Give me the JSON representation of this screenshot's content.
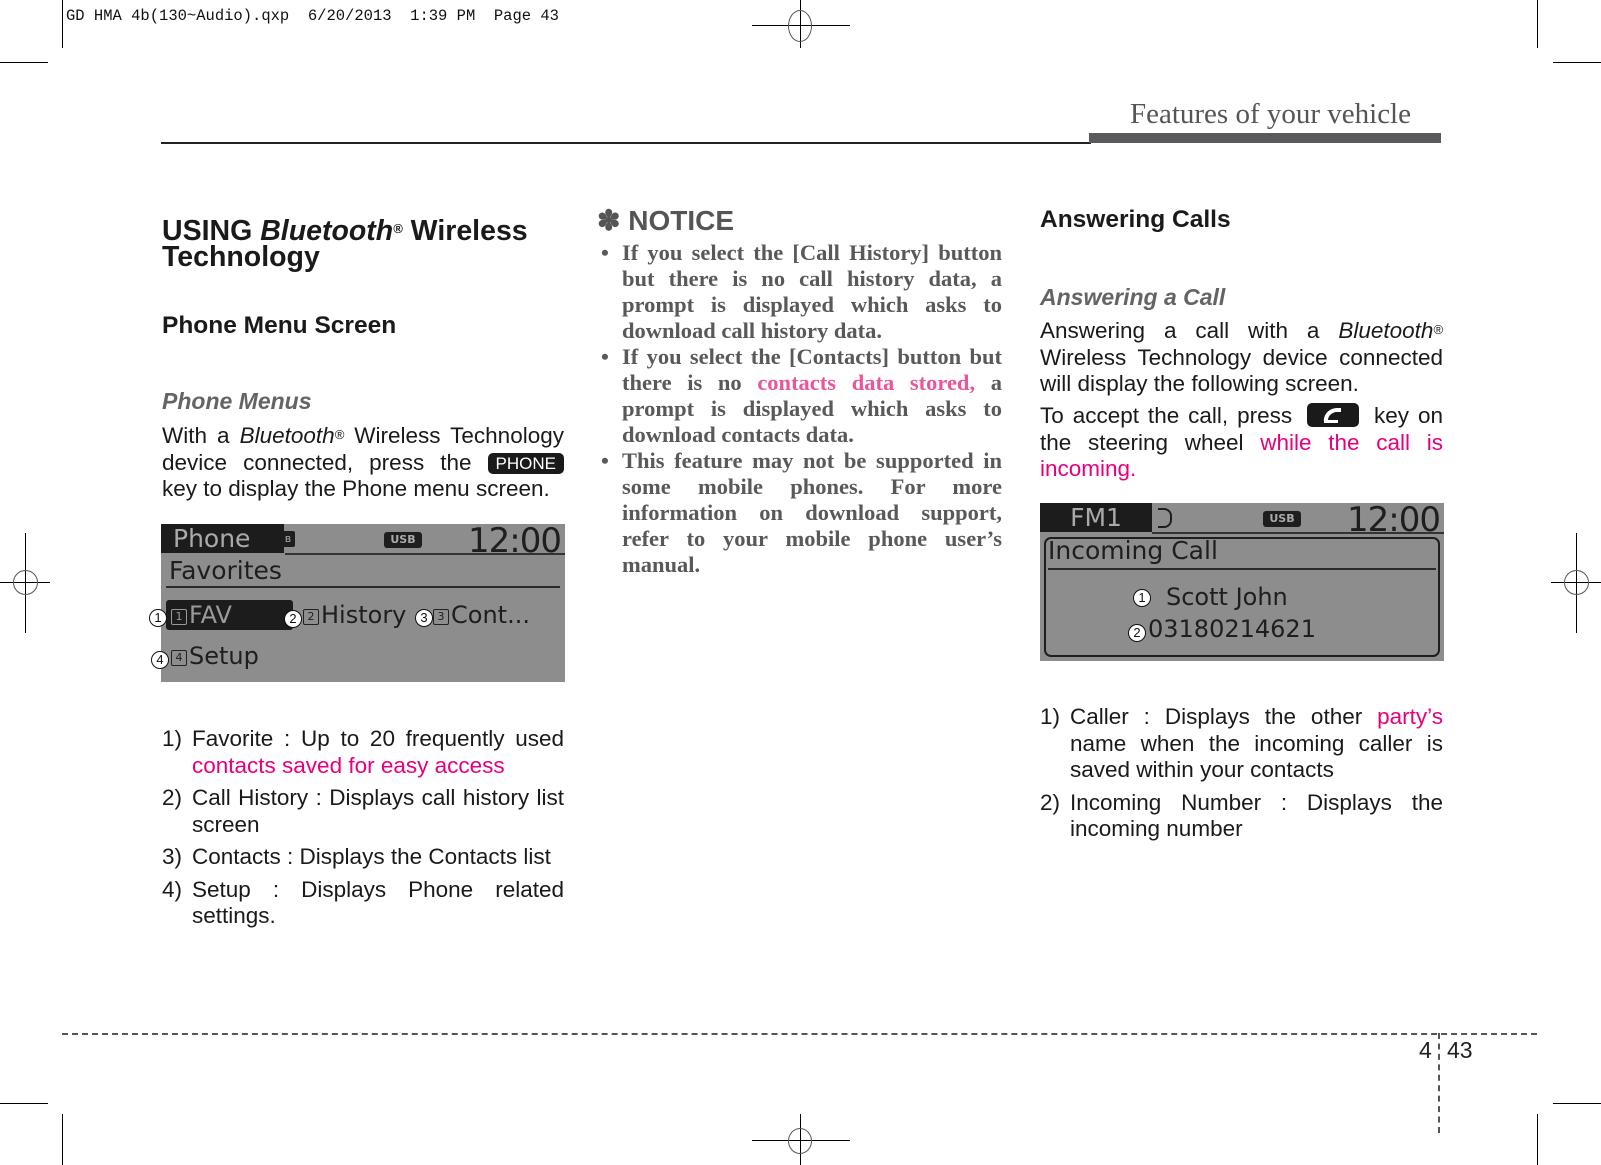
{
  "slug": "GD HMA 4b(130~Audio).qxp  6/20/2013  1:39 PM  Page 43",
  "header": {
    "section_title": "Features of your vehicle"
  },
  "left_column": {
    "title_prefix": "USING ",
    "title_brand": "Bluetooth",
    "title_reg": "®",
    "title_suffix": " Wireless",
    "title_line2": "Technology",
    "subtitle": "Phone Menu Screen",
    "subsection": "Phone Menus",
    "intro_a": "With a ",
    "intro_brand": "Bluetooth",
    "intro_reg": "®",
    "intro_b": " Wireless Technology device connected, press the ",
    "intro_key": "PHONE",
    "intro_c": " key to display the Phone menu screen.",
    "screen": {
      "tab": "Phone",
      "usb": "USB",
      "clock": "12:00",
      "heading": "Favorites",
      "menu": [
        {
          "badge": "1",
          "key": "1",
          "label": "FAV"
        },
        {
          "badge": "2",
          "key": "2",
          "label": "History"
        },
        {
          "badge": "3",
          "key": "3",
          "label": "Cont..."
        },
        {
          "badge": "4",
          "key": "4",
          "label": "Setup"
        }
      ]
    },
    "items": [
      {
        "num": "1)",
        "text": "Favorite : Up to 20 frequently used ",
        "highlight": "contacts saved for easy access"
      },
      {
        "num": "2)",
        "text": "Call History : Displays call history list screen"
      },
      {
        "num": "3)",
        "text": "Contacts : Displays the Contacts list"
      },
      {
        "num": "4)",
        "text": "Setup : Displays Phone related settings."
      }
    ]
  },
  "notice": {
    "symbol": "✽",
    "title": "NOTICE",
    "bullets": [
      {
        "text": "If you select the [Call History] button but there is no call history data, a prompt is displayed which asks to download call history data."
      },
      {
        "text_a": "If you select the [Contacts] button but there is no ",
        "highlight": "contacts data stored,",
        "text_b": " a prompt is displayed which asks to download contacts data."
      },
      {
        "text": "This feature may not be supported in some mobile phones. For more information on download support, refer to your mobile phone user’s manual."
      }
    ]
  },
  "right_column": {
    "title": "Answering Calls",
    "subsection": "Answering a Call",
    "para1_a": "Answering a call with a ",
    "para1_brand": "Bluetooth",
    "para1_reg": "®",
    "para1_b": " Wireless Technology device connected will display the following screen.",
    "para2_a": "To accept the call, press ",
    "para2_b": " key on the steering wheel ",
    "para2_highlight": "while the call is incoming.",
    "screen": {
      "tab": "FM1",
      "usb": "USB",
      "clock": "12:00",
      "heading": "Incoming Call",
      "caller_badge": "1",
      "caller": "Scott John",
      "number_badge": "2",
      "number": "03180214621"
    },
    "items": [
      {
        "num": "1)",
        "text": "Caller : Displays the other ",
        "highlight": "party’s",
        "text_b": " name when the incoming caller is saved within your contacts"
      },
      {
        "num": "2)",
        "text": "Incoming Number : Displays the incoming number"
      }
    ]
  },
  "footer": {
    "chapter": "4",
    "page": "43"
  },
  "colors": {
    "highlight": "#e6007e",
    "notice_text": "#58595b",
    "header_bar": "#5a5a5c"
  }
}
